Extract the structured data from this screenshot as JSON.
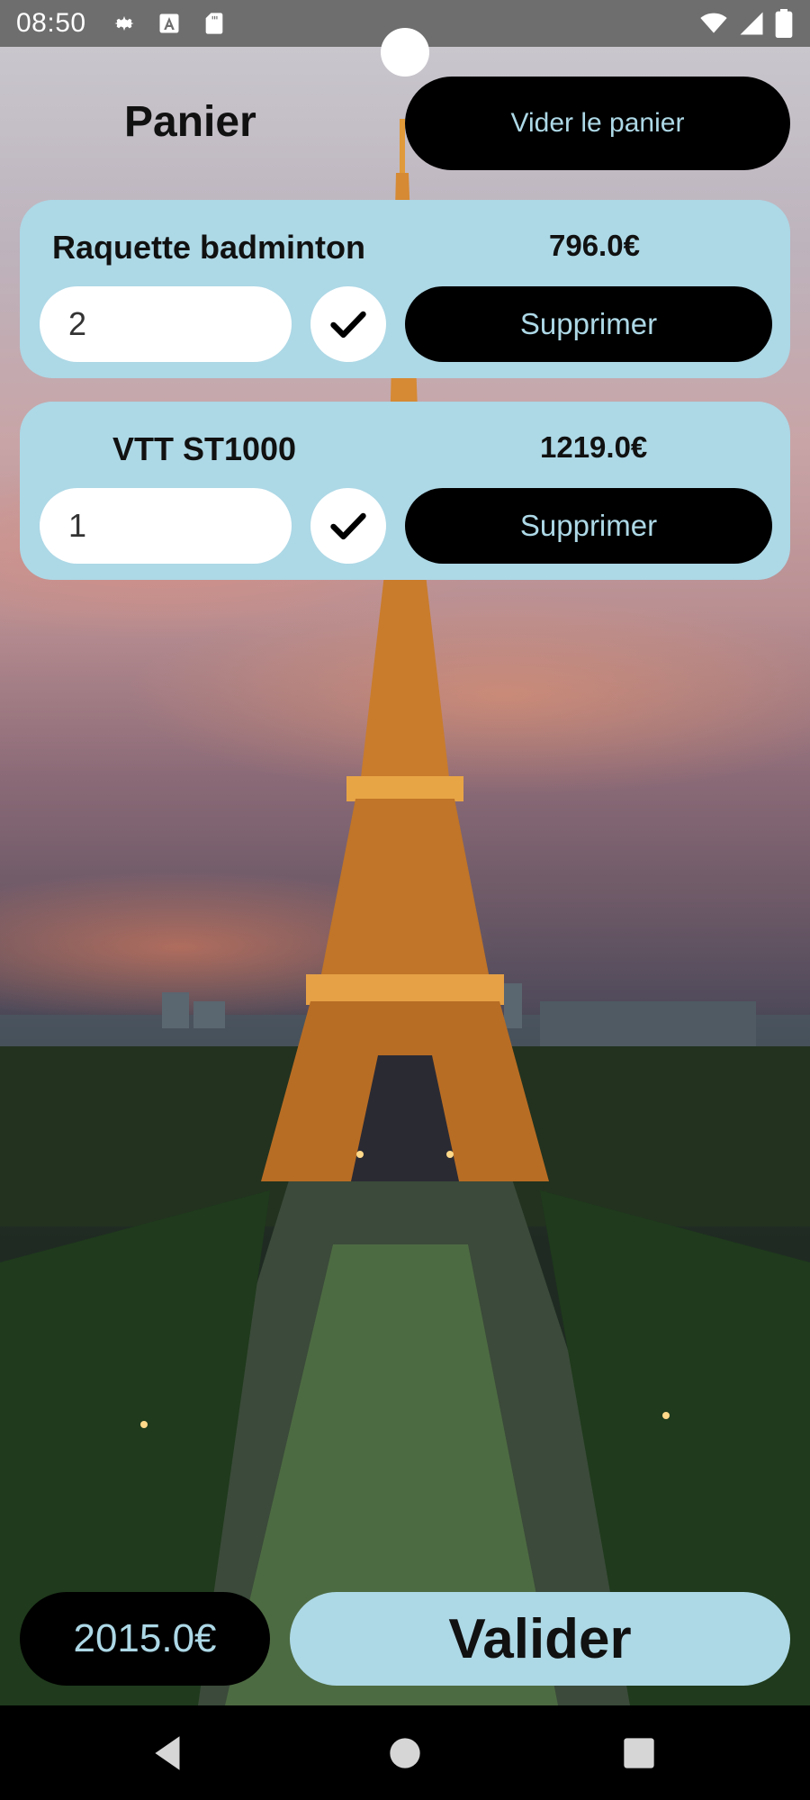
{
  "status_bar": {
    "time": "08:50",
    "left_icons": [
      "settings-icon",
      "accessibility-a-icon",
      "sd-card-icon"
    ],
    "right_icons": [
      "wifi-icon",
      "cell-signal-icon",
      "battery-icon"
    ]
  },
  "header": {
    "title": "Panier",
    "empty_cart_label": "Vider le panier"
  },
  "cart": {
    "items": [
      {
        "name": "Raquette badminton",
        "price": "796.0€",
        "quantity": "2",
        "delete_label": "Supprimer"
      },
      {
        "name": "VTT ST1000",
        "price": "1219.0€",
        "quantity": "1",
        "delete_label": "Supprimer"
      }
    ]
  },
  "footer": {
    "total": "2015.0€",
    "validate_label": "Valider"
  },
  "colors": {
    "accent": "#ADD8E6",
    "button_dark": "#000000",
    "status_bar": "#6E6E6E",
    "nav_bar": "#000000"
  },
  "nav": {
    "buttons": [
      "back-icon",
      "home-icon",
      "recents-icon"
    ]
  }
}
